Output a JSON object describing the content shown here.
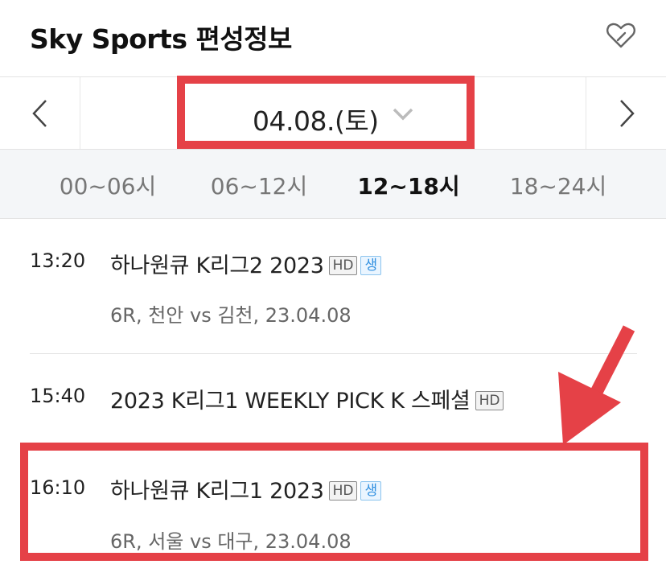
{
  "header": {
    "title": "Sky Sports 편성정보",
    "favorite_icon": "heart-icon"
  },
  "date_bar": {
    "prev_icon": "chevron-left-icon",
    "next_icon": "chevron-right-icon",
    "date": "04.08.(토)",
    "dropdown_icon": "chevron-down-icon"
  },
  "time_tabs": [
    {
      "label": "00~06시",
      "active": false
    },
    {
      "label": "06~12시",
      "active": false
    },
    {
      "label": "12~18시",
      "active": true
    },
    {
      "label": "18~24시",
      "active": false
    }
  ],
  "programs": [
    {
      "time": "13:20",
      "title": "하나원큐 K리그2 2023",
      "badges": [
        "HD",
        "생"
      ],
      "desc": "6R, 천안 vs 김천, 23.04.08"
    },
    {
      "time": "15:40",
      "title": "2023 K리그1 WEEKLY PICK K 스페셜",
      "badges": [
        "HD"
      ],
      "desc": ""
    },
    {
      "time": "16:10",
      "title": "하나원큐 K리그1 2023",
      "badges": [
        "HD",
        "생"
      ],
      "desc": "6R, 서울 vs 대구, 23.04.08"
    }
  ],
  "annotation_color": "#e54147"
}
